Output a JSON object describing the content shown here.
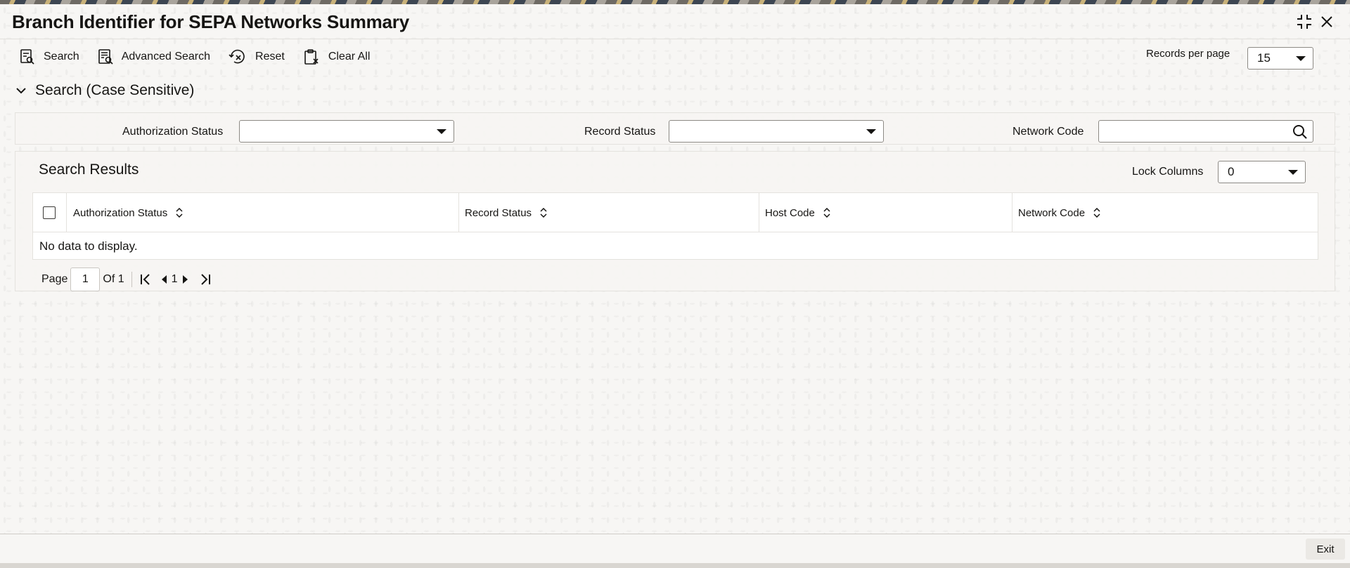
{
  "window": {
    "title": "Branch Identifier for SEPA Networks Summary"
  },
  "toolbar": {
    "search_label": "Search",
    "advanced_search_label": "Advanced Search",
    "reset_label": "Reset",
    "clear_all_label": "Clear All",
    "records_per_page_label": "Records per page",
    "records_per_page_value": "15"
  },
  "search_section": {
    "title": "Search (Case Sensitive)",
    "fields": {
      "authorization_status": {
        "label": "Authorization Status",
        "value": ""
      },
      "record_status": {
        "label": "Record Status",
        "value": ""
      },
      "network_code": {
        "label": "Network Code",
        "value": ""
      }
    }
  },
  "results": {
    "title": "Search Results",
    "lock_columns_label": "Lock Columns",
    "lock_columns_value": "0",
    "columns": [
      "Authorization Status",
      "Record Status",
      "Host Code",
      "Network Code"
    ],
    "rows": [],
    "empty_message": "No data to display."
  },
  "pagination": {
    "page_label": "Page",
    "current_page": "1",
    "of_label": "Of 1",
    "page_number": "1"
  },
  "footer": {
    "exit_label": "Exit"
  },
  "icons": {
    "restore": "collapse-window-icon",
    "close": "close-icon",
    "search": "search-icon",
    "advanced_search": "advanced-search-icon",
    "reset": "reset-icon",
    "clear_all": "clear-all-icon"
  }
}
